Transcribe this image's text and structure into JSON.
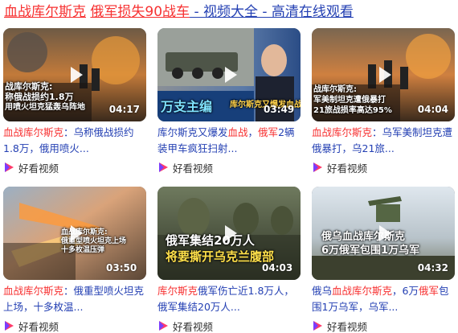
{
  "header": {
    "title_part1": "血战库尔斯克",
    "title_part2": " ",
    "title_part3": "俄军损失90战车",
    "title_part4": " - 视频大全 - 高清在线观看"
  },
  "colors": {
    "link": "#2440b3",
    "highlight": "#f73131"
  },
  "source_icon": "haokan-video-logo",
  "cards": [
    {
      "duration": "04:17",
      "overlay": [
        "战库尔斯克:",
        "称俄战损约1.8万",
        "用喷火坦克猛轰乌阵地"
      ],
      "desc": [
        [
          "r",
          "血战库尔斯克"
        ],
        [
          "n",
          "：乌称俄战损约1.8万，俄用喷火..."
        ]
      ],
      "source": "好看视频"
    },
    {
      "duration": "03:49",
      "overlay": [
        "万支主编",
        "库尔斯克又爆发血战"
      ],
      "desc": [
        [
          "n",
          "库尔斯克又爆发"
        ],
        [
          "r",
          "血战"
        ],
        [
          "n",
          "，"
        ],
        [
          "r",
          "俄军"
        ],
        [
          "n",
          "2辆装甲车疯狂扫射..."
        ]
      ],
      "source": "好看视频"
    },
    {
      "duration": "04:04",
      "overlay": [
        "战库尔斯克:",
        "军美制坦克遭俄暴打",
        "21旅战损率高达95%"
      ],
      "desc": [
        [
          "r",
          "血战库尔斯克"
        ],
        [
          "n",
          "：乌军美制坦克遭俄暴打，乌21旅..."
        ]
      ],
      "source": "好看视频"
    },
    {
      "duration": "03:50",
      "overlay": [
        "血战库尔斯克:",
        "俄重型喷火坦克上场",
        "十多枚温压弹"
      ],
      "desc": [
        [
          "r",
          "血战库尔斯克"
        ],
        [
          "n",
          "：俄重型喷火坦克上场，十多枚温..."
        ]
      ],
      "source": "好看视频"
    },
    {
      "duration": "04:03",
      "overlay": [
        "俄军集结20万人",
        "将要撕开乌克兰腹部"
      ],
      "desc": [
        [
          "r",
          "库尔斯克"
        ],
        [
          "n",
          "俄军伤亡近1.8万人，俄军集结20万人..."
        ]
      ],
      "source": "好看视频"
    },
    {
      "duration": "04:32",
      "overlay": [
        "俄乌血战库尔斯克",
        "6万俄军包围1万乌军"
      ],
      "desc": [
        [
          "n",
          "俄乌"
        ],
        [
          "r",
          "血战库尔斯克"
        ],
        [
          "n",
          "，6万"
        ],
        [
          "r",
          "俄军"
        ],
        [
          "n",
          "包围1万乌军，乌军..."
        ]
      ],
      "source": "好看视频"
    }
  ]
}
